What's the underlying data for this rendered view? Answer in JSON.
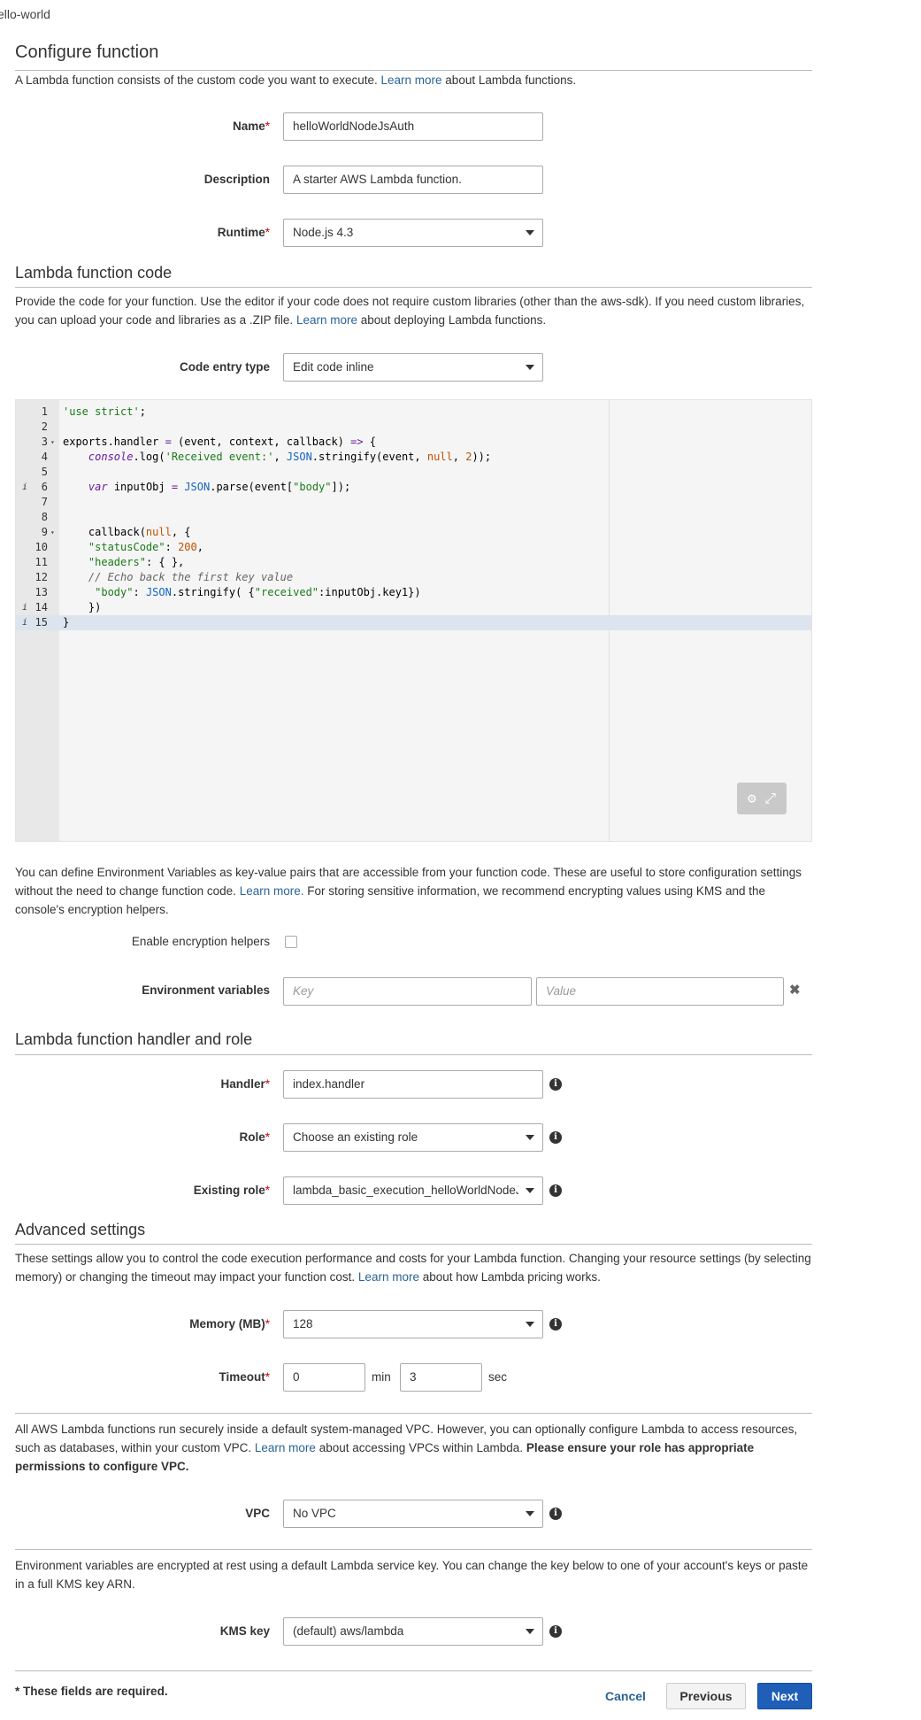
{
  "breadcrumb": "ello-world",
  "configure": {
    "title": "Configure function",
    "intro_before": "A Lambda function consists of the custom code you want to execute. ",
    "intro_link": "Learn more",
    "intro_after": " about Lambda functions.",
    "name_label": "Name",
    "name_value": "helloWorldNodeJsAuth",
    "description_label": "Description",
    "description_value": "A starter AWS Lambda function.",
    "runtime_label": "Runtime",
    "runtime_value": "Node.js 4.3"
  },
  "required_mark": "*",
  "code_section": {
    "title": "Lambda function code",
    "para_before": "Provide the code for your function. Use the editor if your code does not require custom libraries (other than the aws-sdk). If you need custom libraries, you can upload your code and libraries as a .ZIP file. ",
    "para_link": "Learn more",
    "para_after": " about deploying Lambda functions.",
    "entry_type_label": "Code entry type",
    "entry_type_value": "Edit code inline"
  },
  "editor": {
    "lines": [
      {
        "n": "1",
        "code": "'use strict';"
      },
      {
        "n": "2",
        "code": ""
      },
      {
        "n": "3",
        "code": "exports.handler = (event, context, callback) => {"
      },
      {
        "n": "4",
        "code": "    console.log('Received event:', JSON.stringify(event, null, 2));"
      },
      {
        "n": "5",
        "code": ""
      },
      {
        "n": "6",
        "code": "    var inputObj = JSON.parse(event[\"body\"]);"
      },
      {
        "n": "7",
        "code": ""
      },
      {
        "n": "8",
        "code": ""
      },
      {
        "n": "9",
        "code": "    callback(null, {"
      },
      {
        "n": "10",
        "code": "    \"statusCode\": 200,"
      },
      {
        "n": "11",
        "code": "    \"headers\": { },"
      },
      {
        "n": "12",
        "code": "    // Echo back the first key value"
      },
      {
        "n": "13",
        "code": "     \"body\": JSON.stringify( {\"received\":inputObj.key1})"
      },
      {
        "n": "14",
        "code": "    })"
      },
      {
        "n": "15",
        "code": "}"
      }
    ],
    "gutter_marks": {
      "6": "i",
      "14": "i",
      "15": "i"
    },
    "fold_lines": [
      "3",
      "9"
    ],
    "active_line": "15",
    "tools_icons": [
      "gear-icon",
      "expand-icon"
    ]
  },
  "env": {
    "para_before": "You can define Environment Variables as key-value pairs that are accessible from your function code. These are useful to store configuration settings without the need to change function code. ",
    "para_link": "Learn more.",
    "para_after": " For storing sensitive information, we recommend encrypting values using KMS and the console's encryption helpers.",
    "encryption_label": "Enable encryption helpers",
    "vars_label": "Environment variables",
    "key_placeholder": "Key",
    "value_placeholder": "Value"
  },
  "handler_section": {
    "title": "Lambda function handler and role",
    "handler_label": "Handler",
    "handler_value": "index.handler",
    "role_label": "Role",
    "role_value": "Choose an existing role",
    "existing_role_label": "Existing role",
    "existing_role_value": "lambda_basic_execution_helloWorldNodeJsAuth"
  },
  "advanced": {
    "title": "Advanced settings",
    "para_before": "These settings allow you to control the code execution performance and costs for your Lambda function. Changing your resource settings (by selecting memory) or changing the timeout may impact your function cost. ",
    "para_link": "Learn more",
    "para_after": " about how Lambda pricing works.",
    "memory_label": "Memory (MB)",
    "memory_value": "128",
    "timeout_label": "Timeout",
    "timeout_min": "0",
    "min_unit": "min",
    "timeout_sec": "3",
    "sec_unit": "sec"
  },
  "vpc": {
    "para_before": "All AWS Lambda functions run securely inside a default system-managed VPC. However, you can optionally configure Lambda to access resources, such as databases, within your custom VPC. ",
    "para_link": "Learn more",
    "para_after": " about accessing VPCs within Lambda. ",
    "para_bold": "Please ensure your role has appropriate permissions to configure VPC.",
    "label": "VPC",
    "value": "No VPC"
  },
  "kms": {
    "para": "Environment variables are encrypted at rest using a default Lambda service key. You can change the key below to one of your account's keys or paste in a full KMS key ARN.",
    "label": "KMS key",
    "value": "(default) aws/lambda"
  },
  "footer": {
    "note": "* These fields are required.",
    "cancel": "Cancel",
    "previous": "Previous",
    "next": "Next"
  },
  "colors": {
    "link": "#2a6496",
    "primary_button": "#1f5fb8",
    "required": "#c00000"
  }
}
